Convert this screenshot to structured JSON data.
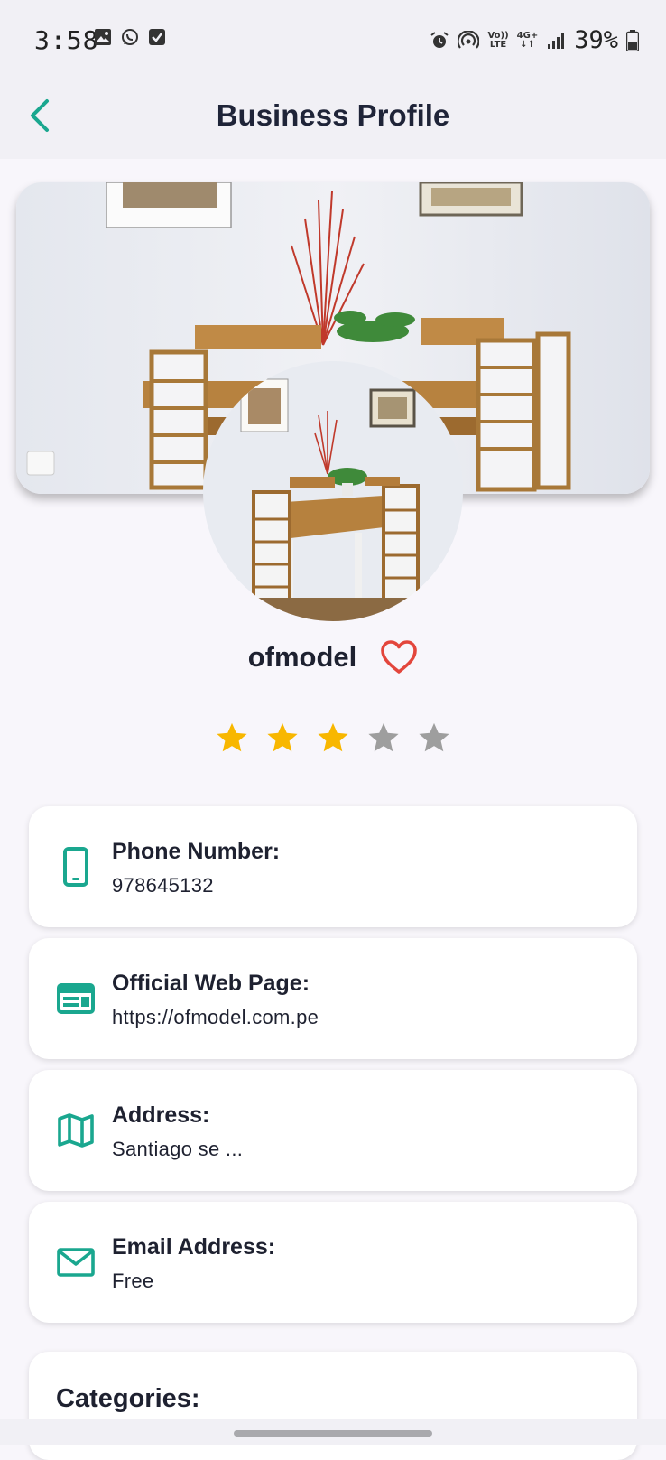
{
  "status_bar": {
    "time": "3:58",
    "volte_top": "Vo))",
    "volte_bottom": "LTE",
    "network_type": "4G+",
    "network_arrows": "↓↑",
    "battery_percent": "39%",
    "left_icons": [
      "gallery-icon",
      "whatsapp-icon",
      "check-icon"
    ],
    "right_icons": [
      "alarm-icon",
      "hotspot-icon",
      "signal-icon",
      "battery-icon"
    ]
  },
  "app_bar": {
    "title": "Business Profile",
    "back_icon": "chevron-left-icon"
  },
  "profile": {
    "name": "ofmodel",
    "favorite_icon": "heart-outline-icon",
    "rating": 3,
    "rating_max": 5
  },
  "info_cards": [
    {
      "icon": "phone-icon",
      "label": "Phone Number:",
      "value": "978645132"
    },
    {
      "icon": "web-icon",
      "label": "Official Web Page:",
      "value": "https://ofmodel.com.pe"
    },
    {
      "icon": "map-icon",
      "label": "Address:",
      "value": "Santiago se ..."
    },
    {
      "icon": "email-icon",
      "label": "Email Address:",
      "value": "Free"
    }
  ],
  "categories": {
    "label": "Categories:"
  },
  "colors": {
    "accent": "#1aa78f",
    "star_filled": "#f8b700",
    "star_empty": "#9e9e9e",
    "heart": "#e3463c",
    "title": "#1f2438"
  }
}
